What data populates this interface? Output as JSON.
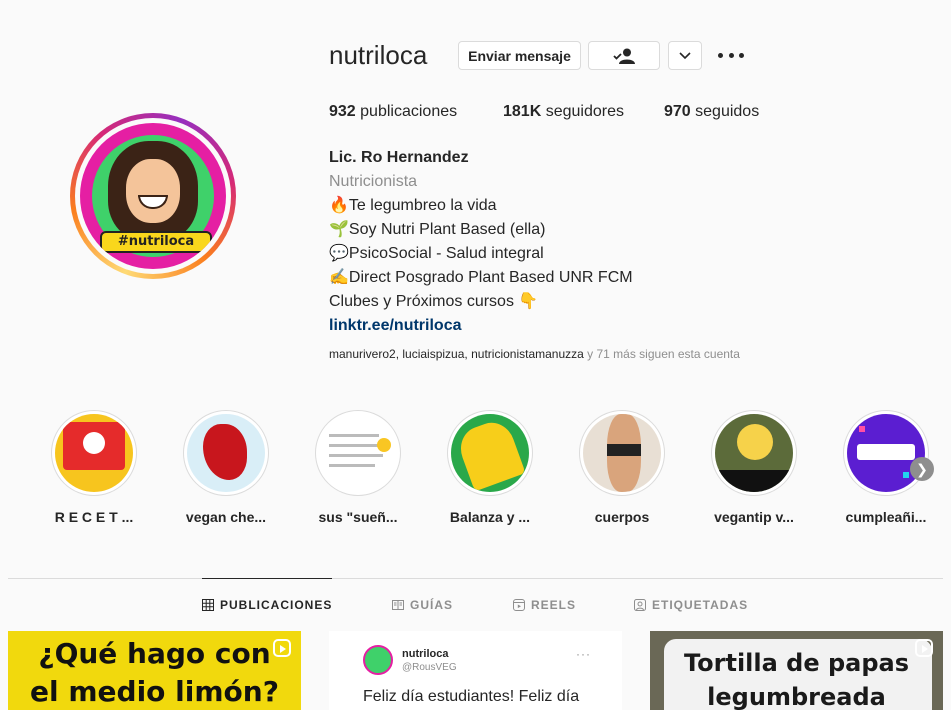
{
  "profile": {
    "username": "nutriloca",
    "avatar_tag": "#nutriloca",
    "buttons": {
      "message": "Enviar mensaje"
    },
    "stats": {
      "posts_count": "932",
      "posts_label": "publicaciones",
      "followers_count": "181K",
      "followers_label": "seguidores",
      "following_count": "970",
      "following_label": "seguidos"
    },
    "bio": {
      "name": "Lic. Ro Hernandez",
      "category": "Nutricionista",
      "lines": [
        "🔥Te legumbreo la vida",
        "🌱Soy Nutri Plant Based (ella)",
        "💬PsicoSocial - Salud integral",
        "✍️Direct Posgrado Plant Based UNR FCM",
        "Clubes y Próximos cursos 👇"
      ],
      "link": "linktr.ee/nutriloca"
    },
    "followed_by": {
      "users": [
        "manurivero2",
        "luciaispizua",
        "nutricionistamanuzza"
      ],
      "sep": ", ",
      "more": " y 71 más siguen esta cuenta"
    }
  },
  "highlights": [
    {
      "label": "R E C E T ...",
      "color": "#f7c51e"
    },
    {
      "label": "vegan che...",
      "color": "#d9eef7"
    },
    {
      "label": "sus \"sueñ...",
      "color": "#ffffff"
    },
    {
      "label": "Balanza y ...",
      "color": "#f7ce1a"
    },
    {
      "label": "cuerpos",
      "color": "#e8dfd4"
    },
    {
      "label": "vegantip v...",
      "color": "#5c6b3a"
    },
    {
      "label": "cumpleañi...",
      "color": "#5b1ed1"
    }
  ],
  "tabs": [
    {
      "label": "PUBLICACIONES",
      "active": true
    },
    {
      "label": "GUÍAS",
      "active": false
    },
    {
      "label": "REELS",
      "active": false
    },
    {
      "label": "ETIQUETADAS",
      "active": false
    }
  ],
  "posts": {
    "p1": {
      "line1": "¿Qué hago con",
      "line2": "el medio limón?"
    },
    "p2": {
      "name": "nutriloca",
      "handle": "@RousVEG",
      "text": "Feliz día estudiantes! Feliz día"
    },
    "p3": {
      "line1": "Tortilla de papas",
      "line2": "legumbreada"
    }
  }
}
